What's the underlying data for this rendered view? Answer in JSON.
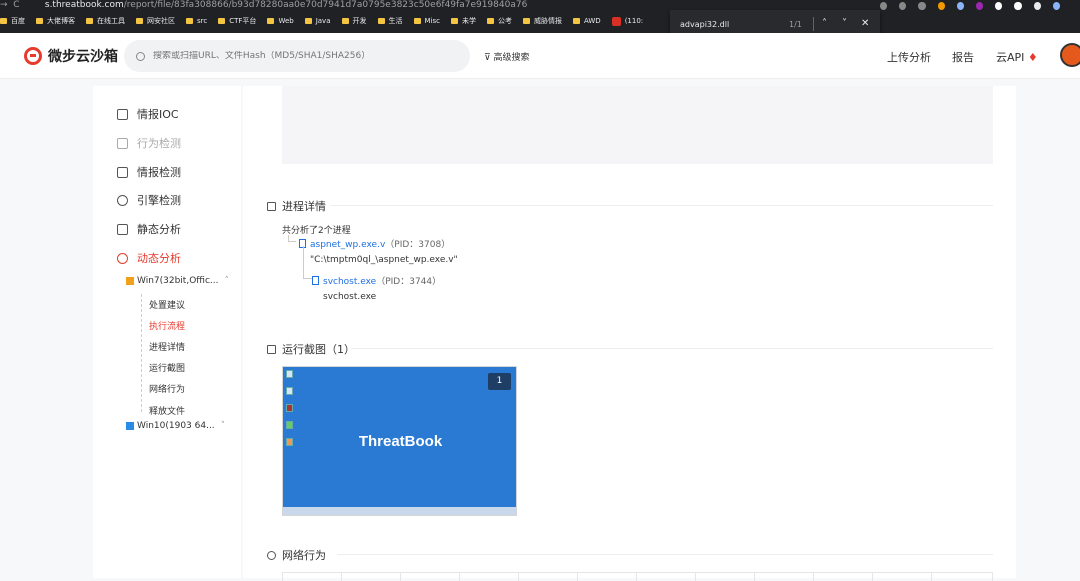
{
  "browser": {
    "url_host": "s.threatbook.com",
    "url_path": "/report/file/83fa308866/b93d78280aa0e70d7941d7a0795e3823c50e6f49fa7e919840a76",
    "bookmarks": [
      "百度",
      "大佬博客",
      "在线工具",
      "网安社区",
      "src",
      "CTF平台",
      "Web",
      "Java",
      "开发",
      "生活",
      "Misc",
      "未学",
      "公考",
      "威胁情报",
      "AWD",
      "(110:"
    ],
    "find": {
      "query": "advapi32.dll",
      "count": "1/1"
    }
  },
  "header": {
    "logo_text": "微步云沙箱",
    "search_placeholder": "搜索或扫描URL、文件Hash（MD5/SHA1/SHA256）",
    "advanced_search": "高级搜索",
    "nav": [
      "上传分析",
      "报告",
      "云API"
    ]
  },
  "sidebar": {
    "items": [
      {
        "label": "情报IOC",
        "icon": "report-icon"
      },
      {
        "label": "行为检测",
        "icon": "image-icon"
      },
      {
        "label": "情报检测",
        "icon": "grid-icon"
      },
      {
        "label": "引擎检测",
        "icon": "question-icon"
      },
      {
        "label": "静态分析",
        "icon": "list-icon"
      },
      {
        "label": "动态分析",
        "icon": "dynamic-icon"
      }
    ],
    "env1": "Win7(32bit,Offic...",
    "subitems": [
      "处置建议",
      "执行流程",
      "进程详情",
      "运行截图",
      "网络行为",
      "释放文件"
    ],
    "env2": "Win10(1903 64..."
  },
  "process": {
    "title": "进程详情",
    "summary": "共分析了2个进程",
    "p1_name": "aspnet_wp.exe.v",
    "p1_pid": "（PID：3708）",
    "p1_cmd": "\"C:\\tmptm0ql_\\aspnet_wp.exe.v\"",
    "p2_name": "svchost.exe",
    "p2_pid": "（PID：3744）",
    "p2_cmd": "svchost.exe"
  },
  "screenshots": {
    "title": "运行截图（1）",
    "brand": "ThreatBook",
    "badge": "1"
  },
  "network": {
    "title": "网络行为"
  },
  "colors": {
    "accent": "#e63a2e",
    "link": "#1f6fe5",
    "screenshot_bg": "#2a7ad4"
  }
}
